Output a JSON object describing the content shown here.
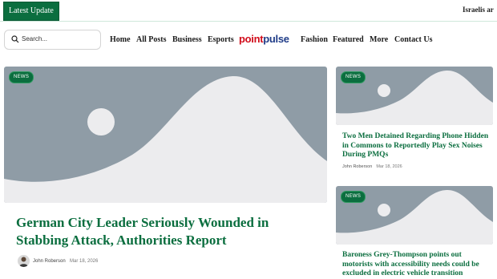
{
  "topbar": {
    "latest_label": "Latest Update",
    "ticker_text": "Israelis ar"
  },
  "search": {
    "placeholder": "Search..."
  },
  "nav": {
    "items": [
      "Home",
      "All Posts",
      "Business",
      "Esports"
    ],
    "logo": {
      "part1": "point",
      "part2": "pulse"
    },
    "items_right": [
      "Fashion",
      "Featured",
      "More",
      "Contact Us"
    ]
  },
  "featured": {
    "badge": "NEWS",
    "title": "German City Leader Seriously Wounded in Stabbing Attack, Authorities Report",
    "author": "John Roberson",
    "date": "Mar 18, 2026"
  },
  "side_posts": [
    {
      "badge": "NEWS",
      "title": "Two Men Detained Regarding Phone Hidden in Commons to Reportedly Play Sex Noises During PMQs",
      "author": "John Roberson",
      "date": "Mar 18, 2026"
    },
    {
      "badge": "NEWS",
      "title": "Baroness Grey-Thompson points out motorists with accessibility needs could be excluded in electric vehicle transition"
    }
  ],
  "colors": {
    "accent": "#0b6e3f",
    "placeholder_bg": "#ececee",
    "placeholder_shape": "#8f9ca6",
    "logo_red": "#d10c1a",
    "logo_blue": "#1f3c88"
  }
}
